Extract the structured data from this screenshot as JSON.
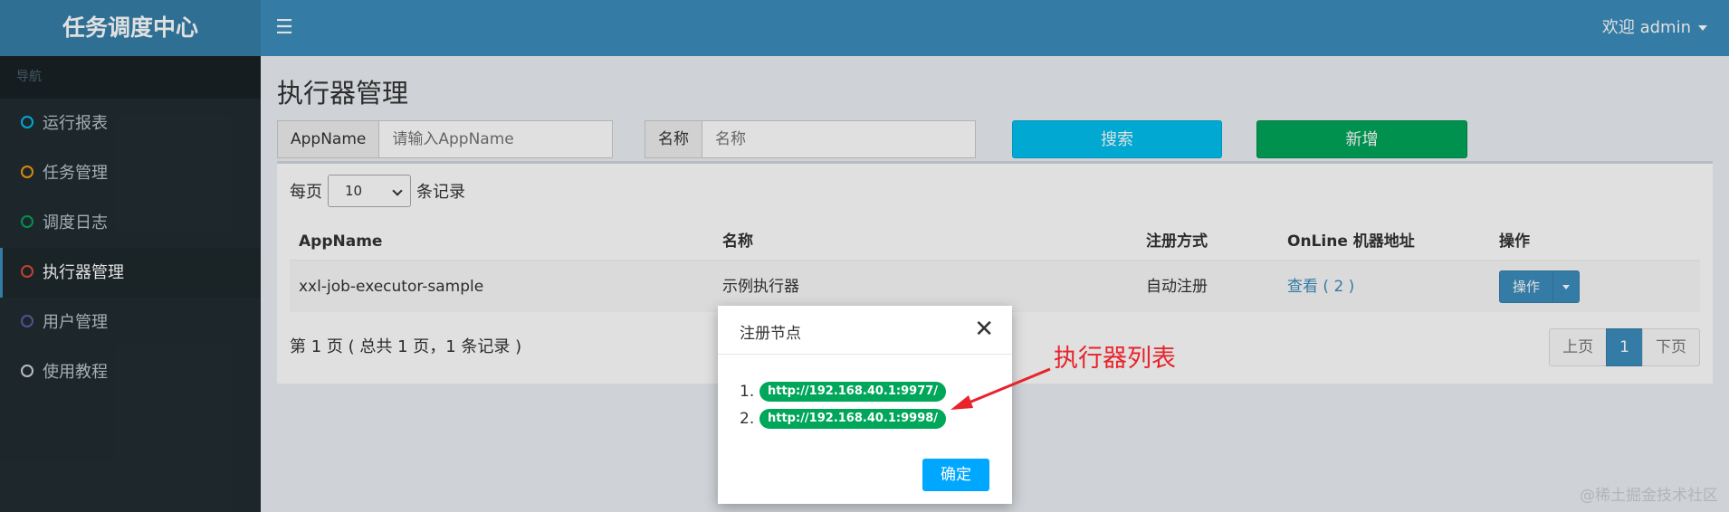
{
  "header": {
    "logo": "任务调度中心",
    "menu_icon": "hamburger-icon",
    "user": "欢迎 admin"
  },
  "sidebar": {
    "header": "导航",
    "items": [
      {
        "label": "运行报表",
        "color": "#00c0ef",
        "active": false
      },
      {
        "label": "任务管理",
        "color": "#f39c12",
        "active": false
      },
      {
        "label": "调度日志",
        "color": "#00a65a",
        "active": false
      },
      {
        "label": "执行器管理",
        "color": "#dd4b39",
        "active": true
      },
      {
        "label": "用户管理",
        "color": "#605ca8",
        "active": false
      },
      {
        "label": "使用教程",
        "color": "#d2d6de",
        "active": false
      }
    ]
  },
  "main": {
    "title": "执行器管理",
    "search": {
      "appname_label": "AppName",
      "appname_placeholder": "请输入AppName",
      "name_label": "名称",
      "name_placeholder": "名称",
      "search_button": "搜索",
      "add_button": "新增"
    },
    "per_page": {
      "prefix": "每页",
      "value": "10",
      "suffix": "条记录"
    },
    "table": {
      "headers": [
        "AppName",
        "名称",
        "注册方式",
        "OnLine 机器地址",
        "操作"
      ],
      "rows": [
        {
          "appname": "xxl-job-executor-sample",
          "name": "示例执行器",
          "reg_type": "自动注册",
          "online": "查看 ( 2 )",
          "action": "操作"
        }
      ]
    },
    "pager": {
      "info": "第 1 页 ( 总共 1 页，1 条记录 )",
      "prev": "上页",
      "current": "1",
      "next": "下页"
    }
  },
  "modal": {
    "title": "注册节点",
    "nodes": [
      {
        "num": "1.",
        "url": "http://192.168.40.1:9977/"
      },
      {
        "num": "2.",
        "url": "http://192.168.40.1:9998/"
      }
    ],
    "ok_button": "确定"
  },
  "annotation": "执行器列表",
  "watermark": "@稀土掘金技术社区",
  "colors": {
    "header": "#3c8dbc",
    "logo_bg": "#367fa9",
    "sidebar": "#222d32",
    "search_btn": "#00c0ef",
    "add_btn": "#00a65a",
    "badge": "#00a65a",
    "ok_btn": "#00a7ff",
    "annotation": "#e8232a"
  }
}
